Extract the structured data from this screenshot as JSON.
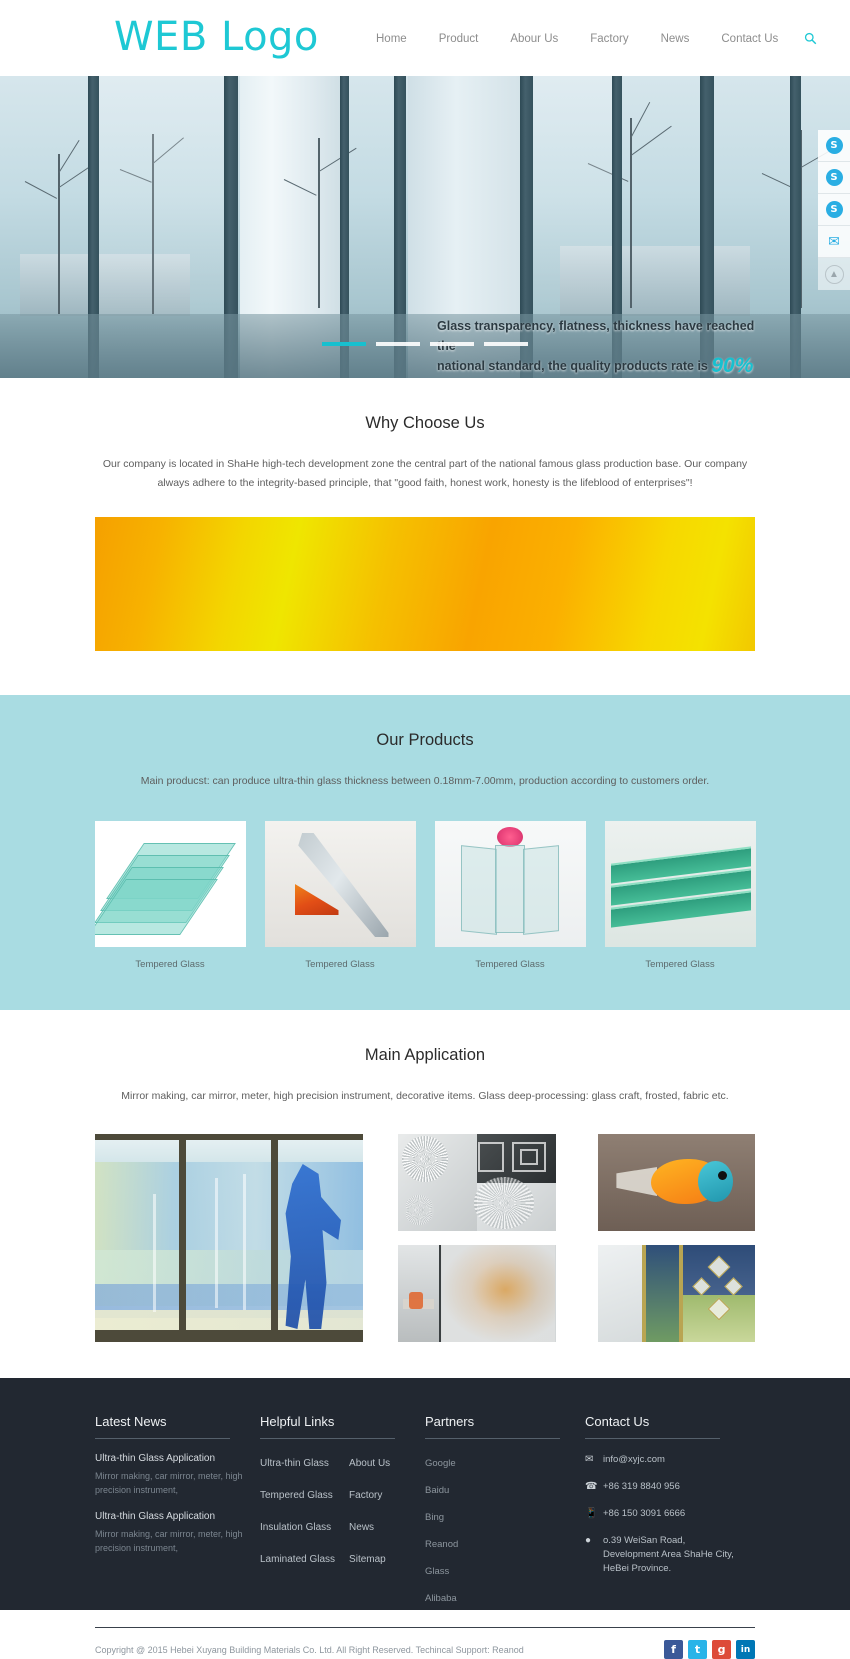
{
  "header": {
    "logo": "WEB Logo",
    "nav": [
      {
        "label": "Home"
      },
      {
        "label": "Product"
      },
      {
        "label": "Abour Us"
      },
      {
        "label": "Factory"
      },
      {
        "label": "News"
      },
      {
        "label": "Contact Us"
      }
    ],
    "search_icon": "search-icon"
  },
  "hero": {
    "caption_line1": "Glass transparency, flatness, thickness have reached the",
    "caption_line2": "national standard, the quality products rate is",
    "percent": "90%",
    "dots": [
      "1",
      "2",
      "3",
      "4"
    ],
    "active_dot": 0
  },
  "side_rail": [
    {
      "name": "skype-1",
      "glyph": "S",
      "type": "skype"
    },
    {
      "name": "skype-2",
      "glyph": "S",
      "type": "skype"
    },
    {
      "name": "skype-3",
      "glyph": "S",
      "type": "skype"
    },
    {
      "name": "email",
      "glyph": "✉",
      "type": "mail"
    },
    {
      "name": "scroll-top",
      "glyph": "▲",
      "type": "top"
    }
  ],
  "why": {
    "title": "Why Choose Us",
    "desc": "Our company is located in ShaHe high-tech development zone the central part of the national famous glass production base. Our company always adhere to the integrity-based principle, that \"good faith, honest work, honesty is the lifeblood of enterprises\"!"
  },
  "products": {
    "title": "Our Products",
    "desc": "Main producst: can produce ultra-thin glass thickness between 0.18mm-7.00mm, production according to customers order.",
    "items": [
      {
        "caption": "Tempered Glass",
        "art": "glass-stack"
      },
      {
        "caption": "Tempered Glass",
        "art": "insulated-unit"
      },
      {
        "caption": "Tempered Glass",
        "art": "clear-sheets"
      },
      {
        "caption": "Tempered Glass",
        "art": "laminated-stack"
      }
    ]
  },
  "applications": {
    "title": "Main Application",
    "desc": "Mirror making, car mirror, meter, high precision instrument, decorative items. Glass deep-processing: glass craft, frosted, fabric etc.",
    "images": [
      {
        "name": "art-glass-window"
      },
      {
        "name": "frosted-patterns"
      },
      {
        "name": "glass-fish-ornament"
      },
      {
        "name": "frosted-office-partition"
      },
      {
        "name": "leaded-stained-glass"
      }
    ]
  },
  "footer": {
    "news": {
      "heading": "Latest News",
      "items": [
        {
          "title": "Ultra-thin Glass Application",
          "excerpt": "Mirror making, car mirror, meter, high precision instrument,"
        },
        {
          "title": "Ultra-thin Glass Application",
          "excerpt": "Mirror making, car mirror, meter, high precision instrument,"
        }
      ]
    },
    "links": {
      "heading": "Helpful Links",
      "col1": [
        "Ultra-thin Glass",
        "Tempered Glass",
        "Insulation Glass",
        "Laminated Glass"
      ],
      "col2": [
        "About Us",
        "Factory",
        "News",
        "Sitemap"
      ]
    },
    "partners": {
      "heading": "Partners",
      "items": [
        "Google",
        "Baidu",
        "Bing",
        "Reanod",
        "Glass",
        "Alibaba"
      ]
    },
    "contact": {
      "heading": "Contact Us",
      "email": "info@xyjc.com",
      "phone": "+86 319 8840 956",
      "mobile": "+86 150 3091 6666",
      "address_line1": "o.39 WeiSan Road,",
      "address_line2": "Development Area ShaHe City,",
      "address_line3": "HeBei Province."
    },
    "copyright": "Copyright @ 2015 Hebei Xuyang Building Materials Co. Ltd. All Right Reserved. Techincal Support: Reanod",
    "socials": [
      {
        "name": "facebook",
        "glyph": "f",
        "color": "#3b5998"
      },
      {
        "name": "twitter",
        "glyph": "t",
        "color": "#29b4e8"
      },
      {
        "name": "google-plus",
        "glyph": "g",
        "color": "#dd4b39"
      },
      {
        "name": "linkedin",
        "glyph": "in",
        "color": "#0077b5"
      }
    ]
  },
  "colors": {
    "accent": "#1ec8d4",
    "products_bg": "#a9dce2",
    "footer_bg": "#222831"
  }
}
